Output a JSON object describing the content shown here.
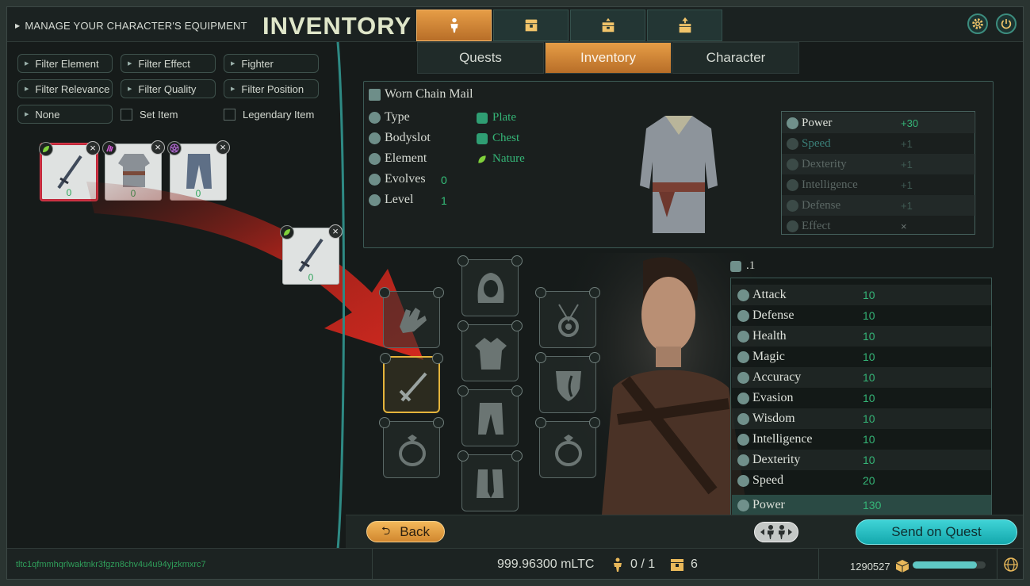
{
  "header": {
    "manage_label": "MANAGE YOUR CHARACTER'S EQUIPMENT",
    "title": "INVENTORY",
    "top_tabs": [
      {
        "icon": "character-icon",
        "active": true
      },
      {
        "icon": "chest-icon",
        "active": false
      },
      {
        "icon": "chest-open-icon",
        "active": false
      },
      {
        "icon": "chest-up-icon",
        "active": false
      }
    ],
    "settings_icon": "gear-icon",
    "power_icon": "power-icon"
  },
  "filters": {
    "row1": [
      "Filter Element",
      "Filter Effect",
      "Fighter"
    ],
    "row2": [
      "Filter Relevance",
      "Filter Quality",
      "Filter Position"
    ],
    "none_label": "None",
    "set_item_label": "Set Item",
    "legendary_item_label": "Legendary Item"
  },
  "inventory_items": [
    {
      "name": "sword",
      "badge": "nature-leaf",
      "count": "0",
      "selected": true
    },
    {
      "name": "chain-mail",
      "badge": "fire-claw",
      "count": "0",
      "selected": false
    },
    {
      "name": "pants",
      "badge": "pentagram",
      "count": "0",
      "selected": false
    }
  ],
  "dragged_item": {
    "name": "sword",
    "badge": "nature-leaf",
    "count": "0"
  },
  "sub_tabs": [
    "Quests",
    "Inventory",
    "Character"
  ],
  "active_sub_tab": "Inventory",
  "item_detail": {
    "name": "Worn Chain Mail",
    "labels": [
      {
        "label": "Type",
        "value": ""
      },
      {
        "label": "Bodyslot",
        "value": ""
      },
      {
        "label": "Element",
        "value": ""
      },
      {
        "label": "Evolves",
        "value": "0"
      },
      {
        "label": "Level",
        "value": "1"
      }
    ],
    "type_value": "Plate",
    "bodyslot_value": "Chest",
    "element_value": "Nature",
    "stats": [
      {
        "name": "Power",
        "value": "+30",
        "active": true
      },
      {
        "name": "Speed",
        "value": "+1",
        "active": false
      },
      {
        "name": "Dexterity",
        "value": "+1",
        "active": false
      },
      {
        "name": "Intelligence",
        "value": "+1",
        "active": false
      },
      {
        "name": "Defense",
        "value": "+1",
        "active": false
      },
      {
        "name": "Effect",
        "value": "×",
        "active": false
      }
    ]
  },
  "hero": {
    "header": ".1",
    "stats": [
      {
        "name": "Attack",
        "value": "10"
      },
      {
        "name": "Defense",
        "value": "10"
      },
      {
        "name": "Health",
        "value": "10"
      },
      {
        "name": "Magic",
        "value": "10"
      },
      {
        "name": "Accuracy",
        "value": "10"
      },
      {
        "name": "Evasion",
        "value": "10"
      },
      {
        "name": "Wisdom",
        "value": "10"
      },
      {
        "name": "Intelligence",
        "value": "10"
      },
      {
        "name": "Dexterity",
        "value": "10"
      },
      {
        "name": "Speed",
        "value": "20"
      }
    ],
    "total": {
      "name": "Power",
      "value": "130"
    }
  },
  "equipment_slots": [
    "gloves",
    "hood",
    "amulet",
    "weapon",
    "chest",
    "shield",
    "ring-left",
    "legs",
    "ring-right",
    "boots"
  ],
  "actions": {
    "back_label": "Back",
    "send_label": "Send on Quest"
  },
  "status": {
    "wallet": "tltc1qfmmhqrlwaktnkr3fgzn8chv4u4u94yjzkmxrc7",
    "balance": "999.96300 mLTC",
    "party": "0 / 1",
    "chests": "6",
    "gold": "1290527",
    "progress_fraction": 0.88
  },
  "colors": {
    "accent_orange": "#e69d46",
    "accent_teal": "#3fd3d6",
    "stat_green": "#35b577",
    "selected_gold": "#e5b43c",
    "selected_red": "#c0283a"
  }
}
